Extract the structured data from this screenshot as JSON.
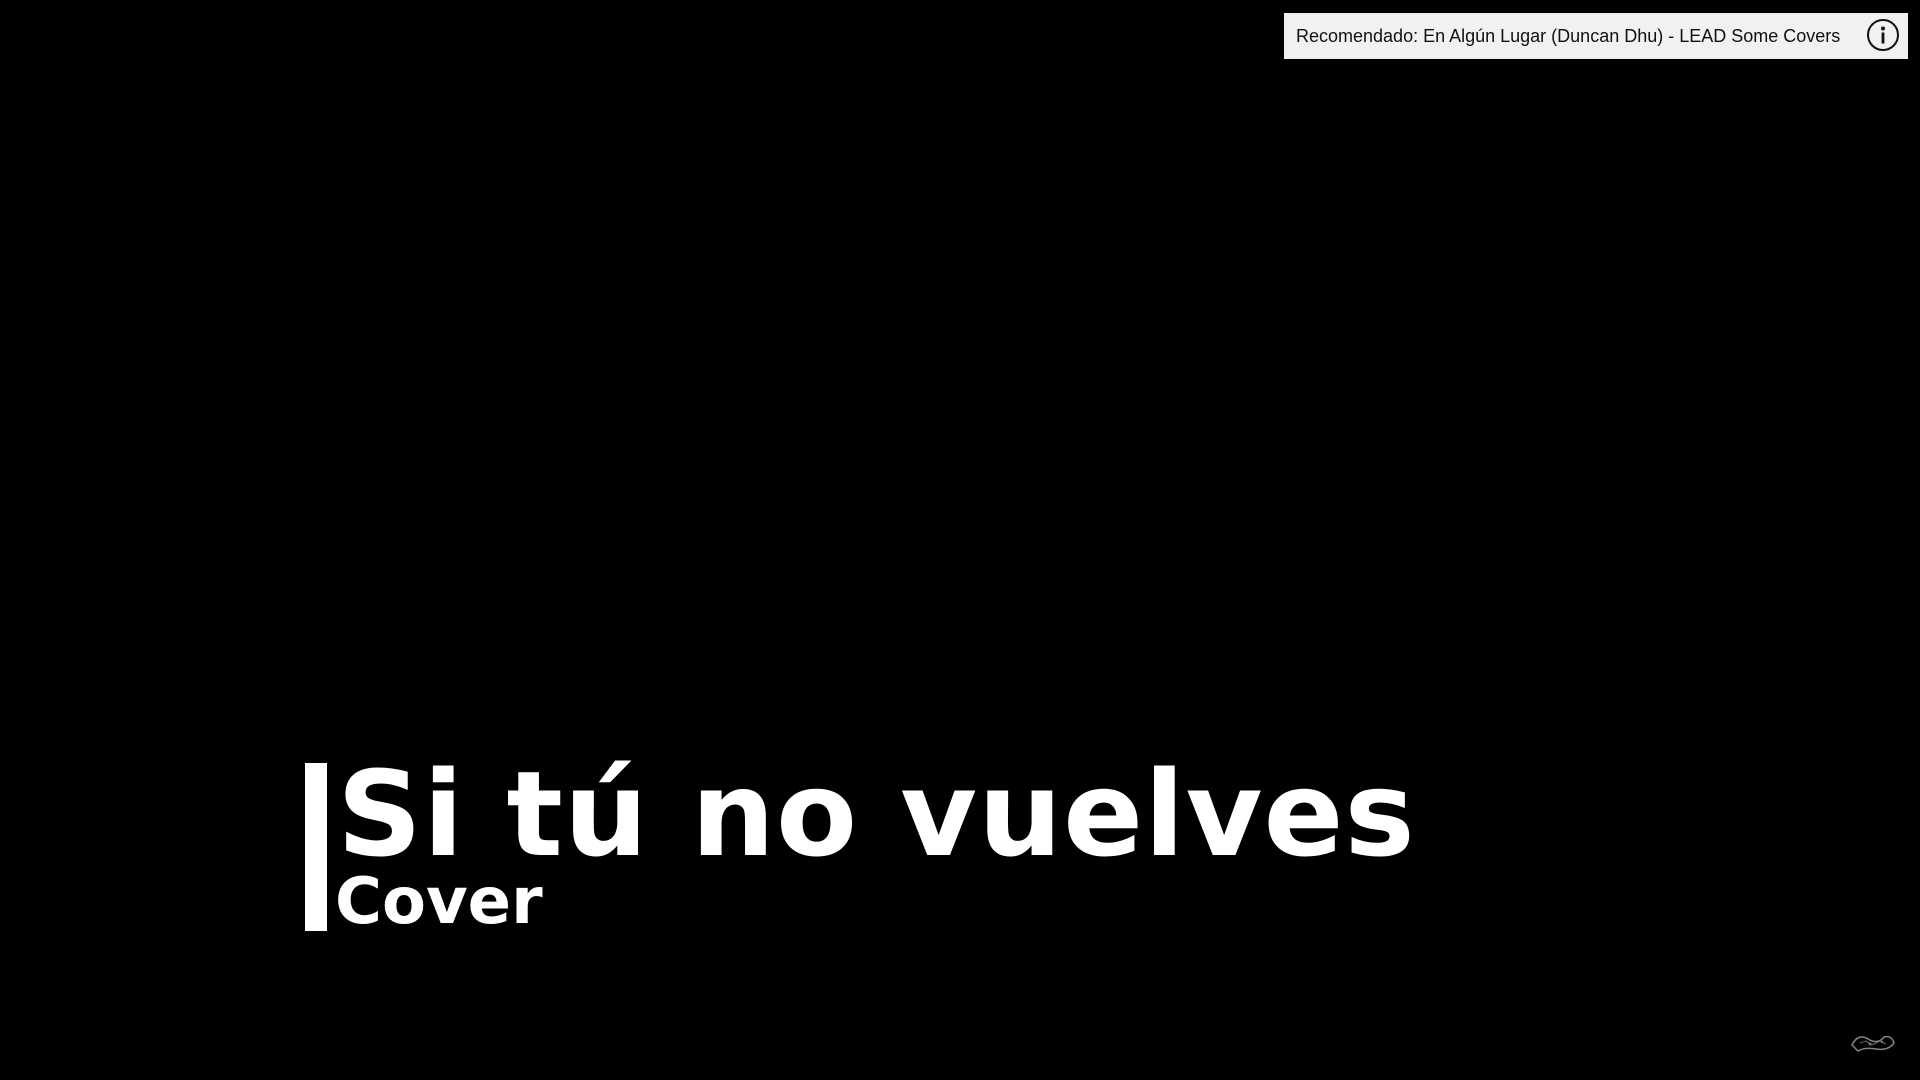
{
  "video": {
    "title_main": "Si tú no vuelves",
    "title_sub": "Cover"
  },
  "recommendation": {
    "text": "Recomendado: En Algún Lugar (Duncan Dhu) - LEAD Some Covers",
    "icon": "info-icon"
  },
  "watermark": {
    "icon": "channel-watermark-icon"
  },
  "colors": {
    "background": "#000000",
    "title": "#ffffff",
    "card_background": "#f1f1f1",
    "card_text": "#111111"
  }
}
